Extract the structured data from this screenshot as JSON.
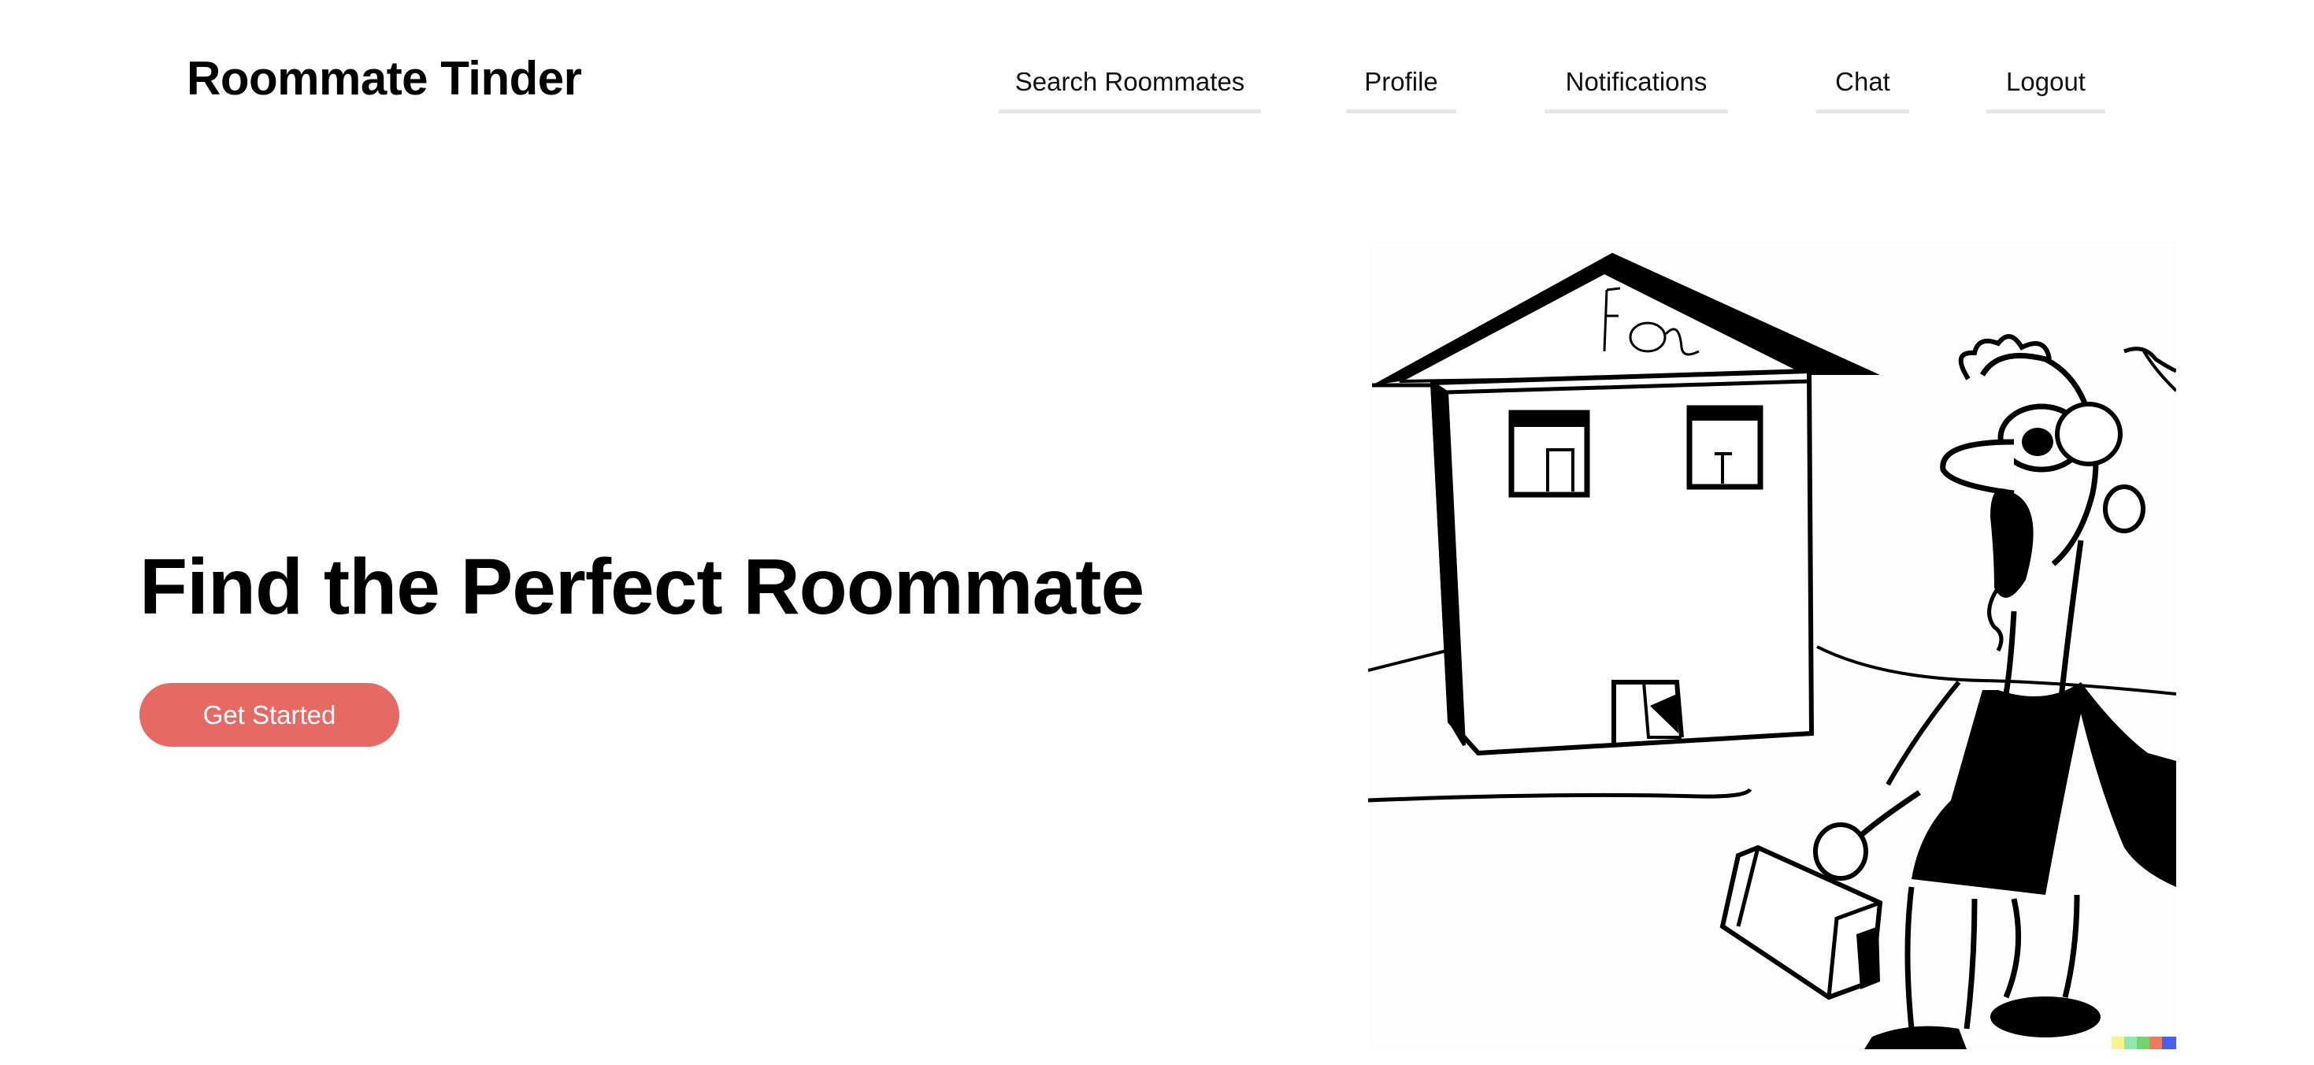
{
  "app": {
    "logo_text": "Roommate Tinder"
  },
  "nav": {
    "items": [
      {
        "label": "Search Roommates"
      },
      {
        "label": "Profile"
      },
      {
        "label": "Notifications"
      },
      {
        "label": "Chat"
      },
      {
        "label": "Logout"
      }
    ]
  },
  "hero": {
    "title": "Find the Perfect Roommate",
    "cta_label": "Get Started",
    "cta_color": "#e46a63"
  },
  "illustration": {
    "subject": "house-and-roommate-drawing"
  }
}
